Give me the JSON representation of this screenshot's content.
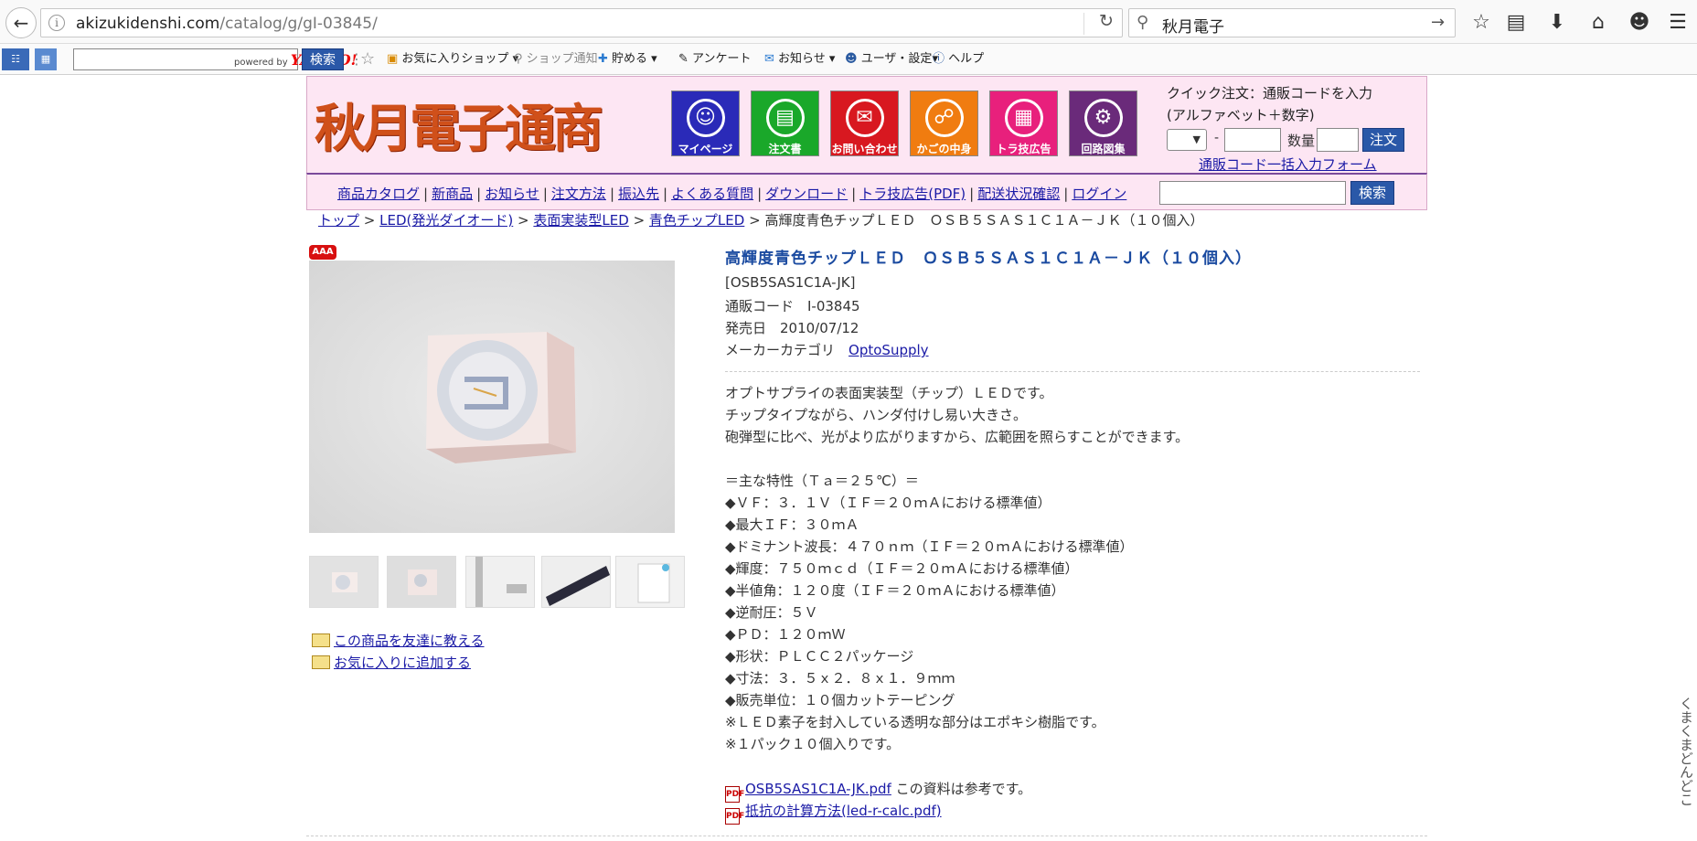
{
  "browser": {
    "url_host": "akizukidenshi.com",
    "url_path": "/catalog/g/gI-03845/",
    "search_text": "秋月電子"
  },
  "toolbar2": {
    "yahoo_powered": "powered by",
    "yahoo_brand": "YAHOO!",
    "yahoo_search": "検索",
    "fav_shop": "お気に入りショップ",
    "shop_notice": "ショップ通知",
    "save": "貯める",
    "survey": "アンケート",
    "notice": "お知らせ",
    "user_settings": "ユーザ・設定",
    "help": "ヘルプ"
  },
  "header": {
    "logo": "秋月電子通商",
    "buttons": [
      {
        "label": "マイページ",
        "icon": "person-icon",
        "color": "#2a2ab8"
      },
      {
        "label": "注文書",
        "icon": "order-form-icon",
        "color": "#1aa82a"
      },
      {
        "label": "お問い合わせ",
        "icon": "mail-icon",
        "color": "#d81820"
      },
      {
        "label": "かごの中身",
        "icon": "cart-icon",
        "color": "#f07c10"
      },
      {
        "label": "トラ技広告",
        "icon": "magazine-icon",
        "color": "#e8207c"
      },
      {
        "label": "回路図集",
        "icon": "circuit-book-icon",
        "color": "#6a2a7a"
      }
    ],
    "quick_title": "クイック注文：通販コードを入力",
    "quick_sub": "(アルファベット＋数字)",
    "quick_dash": "-",
    "quick_qty_label": "数量",
    "quick_order_btn": "注文",
    "quick_bulk_link": "通販コード一括入力フォーム"
  },
  "nav": {
    "links": [
      "商品カタログ",
      "新商品",
      "お知らせ",
      "注文方法",
      "振込先",
      "よくある質問",
      "ダウンロード",
      "トラ技広告(PDF)",
      "配送状況確認",
      "ログイン"
    ],
    "sep": "|",
    "search_btn": "検索"
  },
  "breadcrumb": {
    "items": [
      "トップ",
      "LED(発光ダイオード)",
      "表面実装型LED",
      "青色チップLED"
    ],
    "sep": ">",
    "current": "高輝度青色チップＬＥＤ　ＯＳＢ５ＳＡＳ１Ｃ１Ａ－ＪＫ（１０個入）"
  },
  "product": {
    "badge": "AAA",
    "title": "高輝度青色チップＬＥＤ　ＯＳＢ５ＳＡＳ１Ｃ１Ａ－ＪＫ（１０個入）",
    "model": "[OSB5SAS1C1A-JK]",
    "code_line": "通販コード　I-03845",
    "date_line": "発売日　2010/07/12",
    "maker_label": "メーカーカテゴリ",
    "maker": "OptoSupply",
    "share_friend": "この商品を友達に教える",
    "share_fav": "お気に入りに追加する",
    "description": [
      "オプトサプライの表面実装型（チップ）ＬＥＤです。",
      "チップタイプながら、ハンダ付けし易い大きさ。",
      "砲弾型に比べ、光がより広がりますから、広範囲を照らすことができます。",
      "",
      "＝主な特性（Ｔａ＝２５℃）＝",
      "◆ＶＦ：３．１Ｖ（ＩＦ＝２０ｍＡにおける標準値）",
      "◆最大ＩＦ：３０ｍＡ",
      "◆ドミナント波長：４７０ｎｍ（ＩＦ＝２０ｍＡにおける標準値）",
      "◆輝度：７５０ｍｃｄ（ＩＦ＝２０ｍＡにおける標準値）",
      "◆半値角：１２０度（ＩＦ＝２０ｍＡにおける標準値）",
      "◆逆耐圧：５Ｖ",
      "◆ＰＤ：１２０ｍＷ",
      "◆形状：ＰＬＣＣ２パッケージ",
      "◆寸法：３．５ｘ２．８ｘ１．９ｍｍ",
      "◆販売単位：１０個カットテーピング",
      "※ＬＥＤ素子を封入している透明な部分はエポキシ樹脂です。",
      "※１パック１０個入りです。"
    ],
    "docs": [
      {
        "link": "OSB5SAS1C1A-JK.pdf",
        "note": "この資料は参考です。"
      },
      {
        "link": "抵抗の計算方法(led-r-calc.pdf)",
        "note": ""
      }
    ],
    "pdf_icon": "PDF"
  },
  "side_vertical_text": "くまくまどんどこ"
}
